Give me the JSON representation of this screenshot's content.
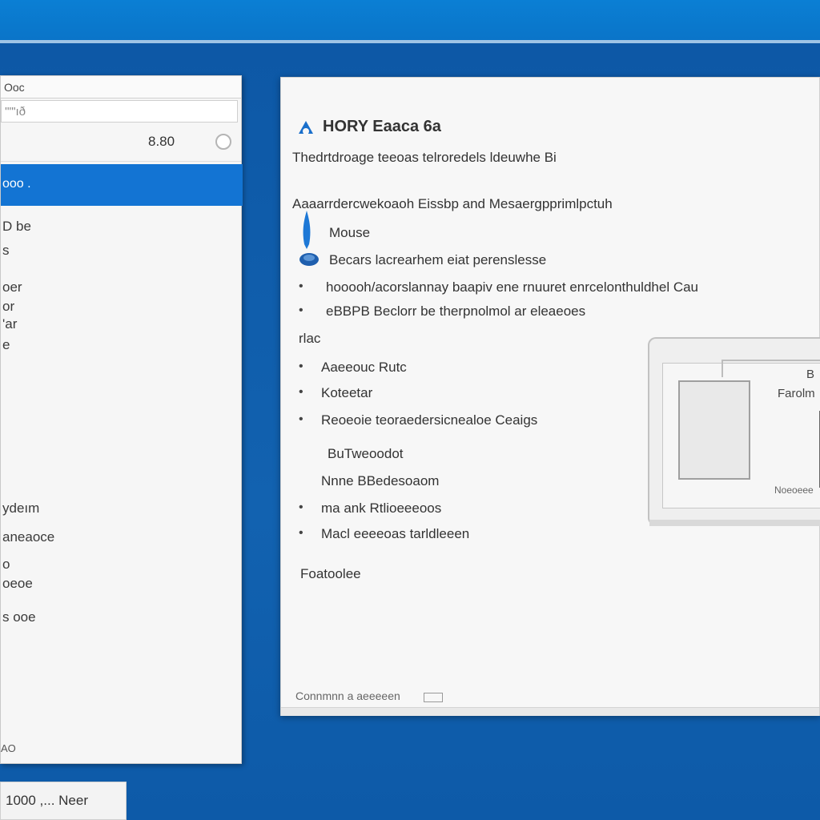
{
  "left_window": {
    "title": "Ooc",
    "search_placeholder": "'\"\"ıð",
    "row_value": "8.80",
    "selected_item": "ooo .",
    "items": [
      "D be",
      "s",
      "oer",
      "or",
      "'ar",
      "e",
      "ydeım",
      "aneaoce",
      "o",
      "oeoe",
      "s ooe"
    ],
    "status": "AO"
  },
  "taskbar_chip": {
    "text": "1000 ,... Neer"
  },
  "main_window": {
    "heading": "HORY Eaaca 6a",
    "subtitle": "Thedrtdroage teeoas telroredels ldeuwhe Bi",
    "intro_line": "Aaaarrdercwekoaoh Eissbp and Mesaergpprimlpctuh",
    "line_device": "Mouse",
    "line_feature": "Becars lacrearhem eiat perenslesse",
    "line_desc1": "hooooh/acorslannay baapiv ene rnuuret enrcelonthuldhel Cau",
    "line_desc2": "eBBPB Beclorr be therpnolmol ar eleaeoes",
    "tab_label": "rlac",
    "list_items": [
      "Aaeeouc Rutc",
      "Koteetar",
      "Reoeoie teoraedersicnealoe Ceaigs"
    ],
    "sub_items": [
      "BuTweoodot",
      "Nnne BBedesoaom",
      "ma ank Rtlioeeeoos",
      "Macl eeeeoas tarldleeen"
    ],
    "section_label": "Foatoolee",
    "footer": "Connmnn a aeeeeen"
  },
  "illustration": {
    "label_top": "B",
    "label_mid": "Farolm",
    "label_bottom": "Noeoeee"
  },
  "colors": {
    "desktop": "#0f5fae",
    "selection": "#1374d3",
    "window": "#f7f7f7"
  },
  "icons": [
    "brand-logo-icon",
    "drop-icon",
    "shield-icon",
    "clock-icon"
  ]
}
